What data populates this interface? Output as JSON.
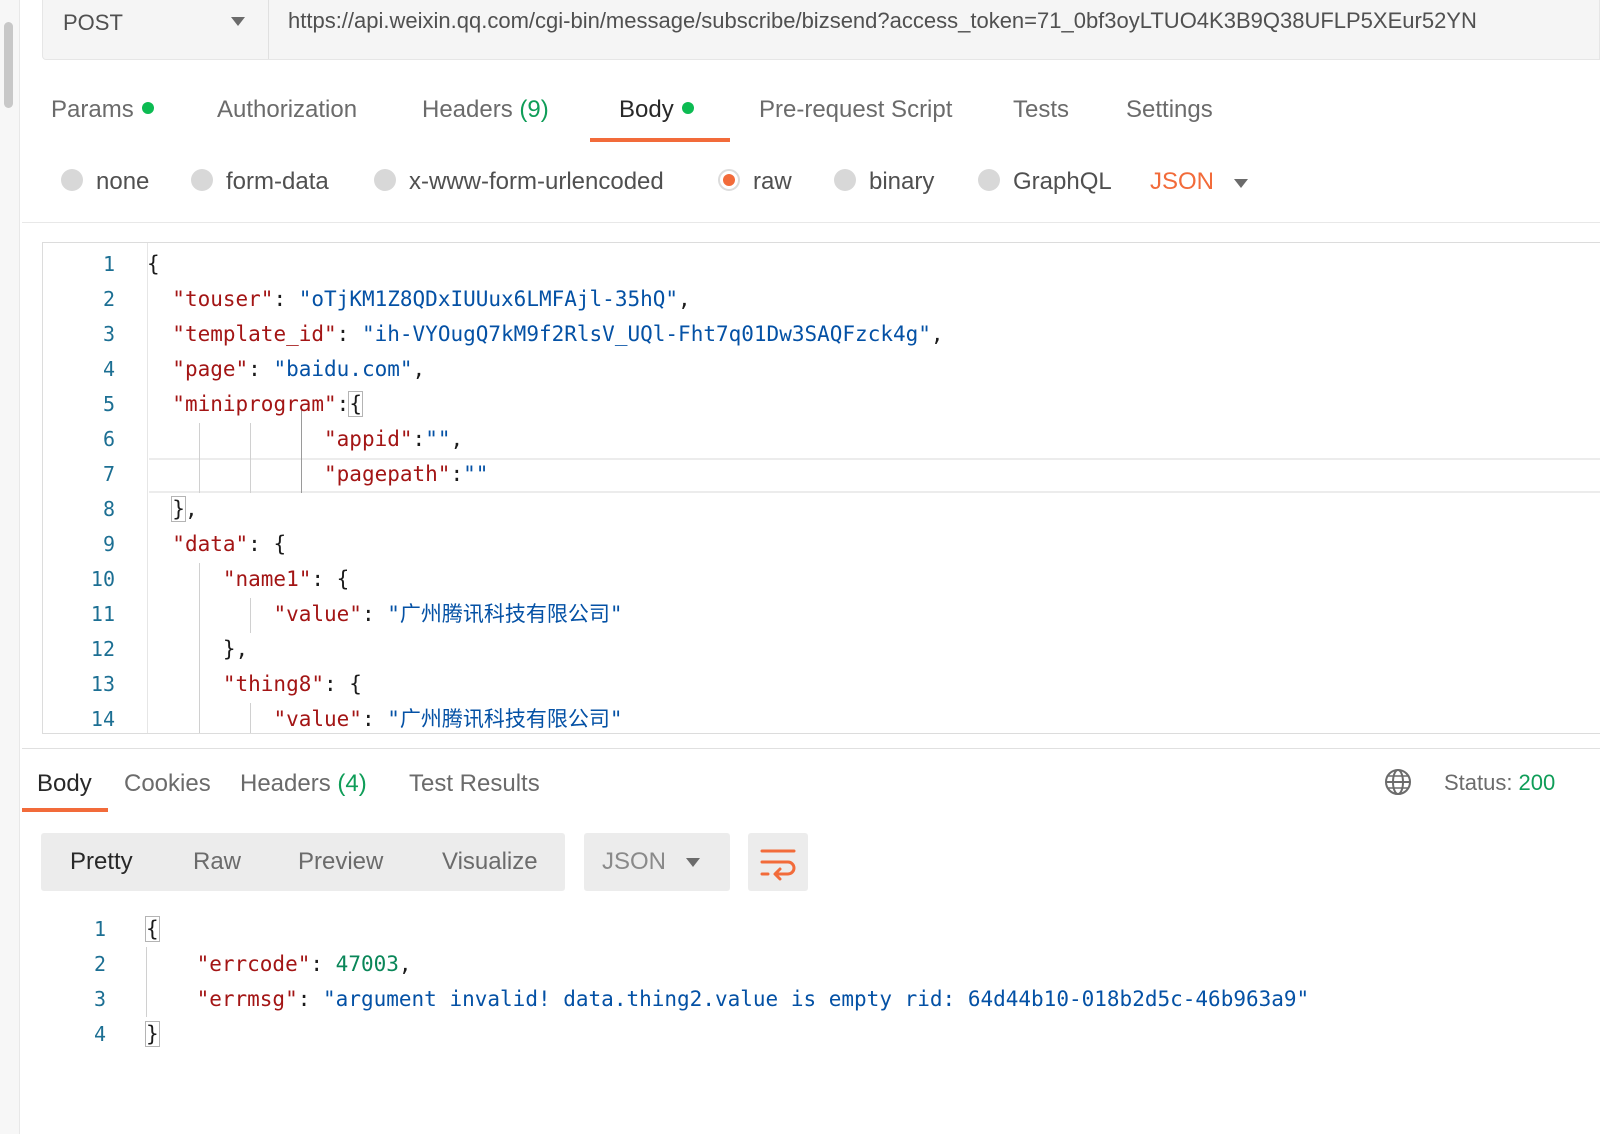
{
  "request": {
    "method": "POST",
    "url": "https://api.weixin.qq.com/cgi-bin/message/subscribe/bizsend?access_token=71_0bf3oyLTUO4K3B9Q38UFLP5XEur52YN"
  },
  "request_tabs": [
    {
      "label": "Params",
      "dot": true
    },
    {
      "label": "Authorization"
    },
    {
      "label": "Headers",
      "count": "(9)"
    },
    {
      "label": "Body",
      "dot": true,
      "active": true
    },
    {
      "label": "Pre-request Script"
    },
    {
      "label": "Tests"
    },
    {
      "label": "Settings"
    }
  ],
  "body_types": {
    "options": [
      "none",
      "form-data",
      "x-www-form-urlencoded",
      "raw",
      "binary",
      "GraphQL"
    ],
    "selected": "raw",
    "format": "JSON"
  },
  "request_body_lines": [
    {
      "n": "1"
    },
    {
      "n": "2"
    },
    {
      "n": "3"
    },
    {
      "n": "4"
    },
    {
      "n": "5"
    },
    {
      "n": "6"
    },
    {
      "n": "7"
    },
    {
      "n": "8"
    },
    {
      "n": "9"
    },
    {
      "n": "10"
    },
    {
      "n": "11"
    },
    {
      "n": "12"
    },
    {
      "n": "13"
    },
    {
      "n": "14"
    }
  ],
  "request_body": {
    "touser_key": "\"touser\"",
    "touser_val": "\"oTjKM1Z8QDxIUUux6LMFAjl-35hQ\"",
    "template_key": "\"template_id\"",
    "template_val": "\"ih-VYOugQ7kM9f2RlsV_UQl-Fht7q01Dw3SAQFzck4g\"",
    "page_key": "\"page\"",
    "page_val": "\"baidu.com\"",
    "mini_key": "\"miniprogram\"",
    "appid_key": "\"appid\"",
    "appid_val": "\"\"",
    "pagepath_key": "\"pagepath\"",
    "pagepath_val": "\"\"",
    "data_key": "\"data\"",
    "name1_key": "\"name1\"",
    "value_key": "\"value\"",
    "company": "\"广州腾讯科技有限公司\"",
    "thing8_key": "\"thing8\""
  },
  "response_tabs": [
    {
      "label": "Body",
      "active": true
    },
    {
      "label": "Cookies"
    },
    {
      "label": "Headers",
      "count": "(4)"
    },
    {
      "label": "Test Results"
    }
  ],
  "status": {
    "label": "Status:",
    "value": "200"
  },
  "view_modes": [
    "Pretty",
    "Raw",
    "Preview",
    "Visualize"
  ],
  "response_format": "JSON",
  "response_lines": [
    "1",
    "2",
    "3",
    "4"
  ],
  "response_body": {
    "errcode_key": "\"errcode\"",
    "errcode_val": "47003",
    "errmsg_key": "\"errmsg\"",
    "errmsg_val": "\"argument invalid! data.thing2.value is empty rid: 64d44b10-018b2d5c-46b963a9\""
  },
  "colors": {
    "accent": "#f26b3a",
    "success": "#0cbb52",
    "key": "#a31515",
    "string": "#0451a5",
    "number": "#098658"
  }
}
